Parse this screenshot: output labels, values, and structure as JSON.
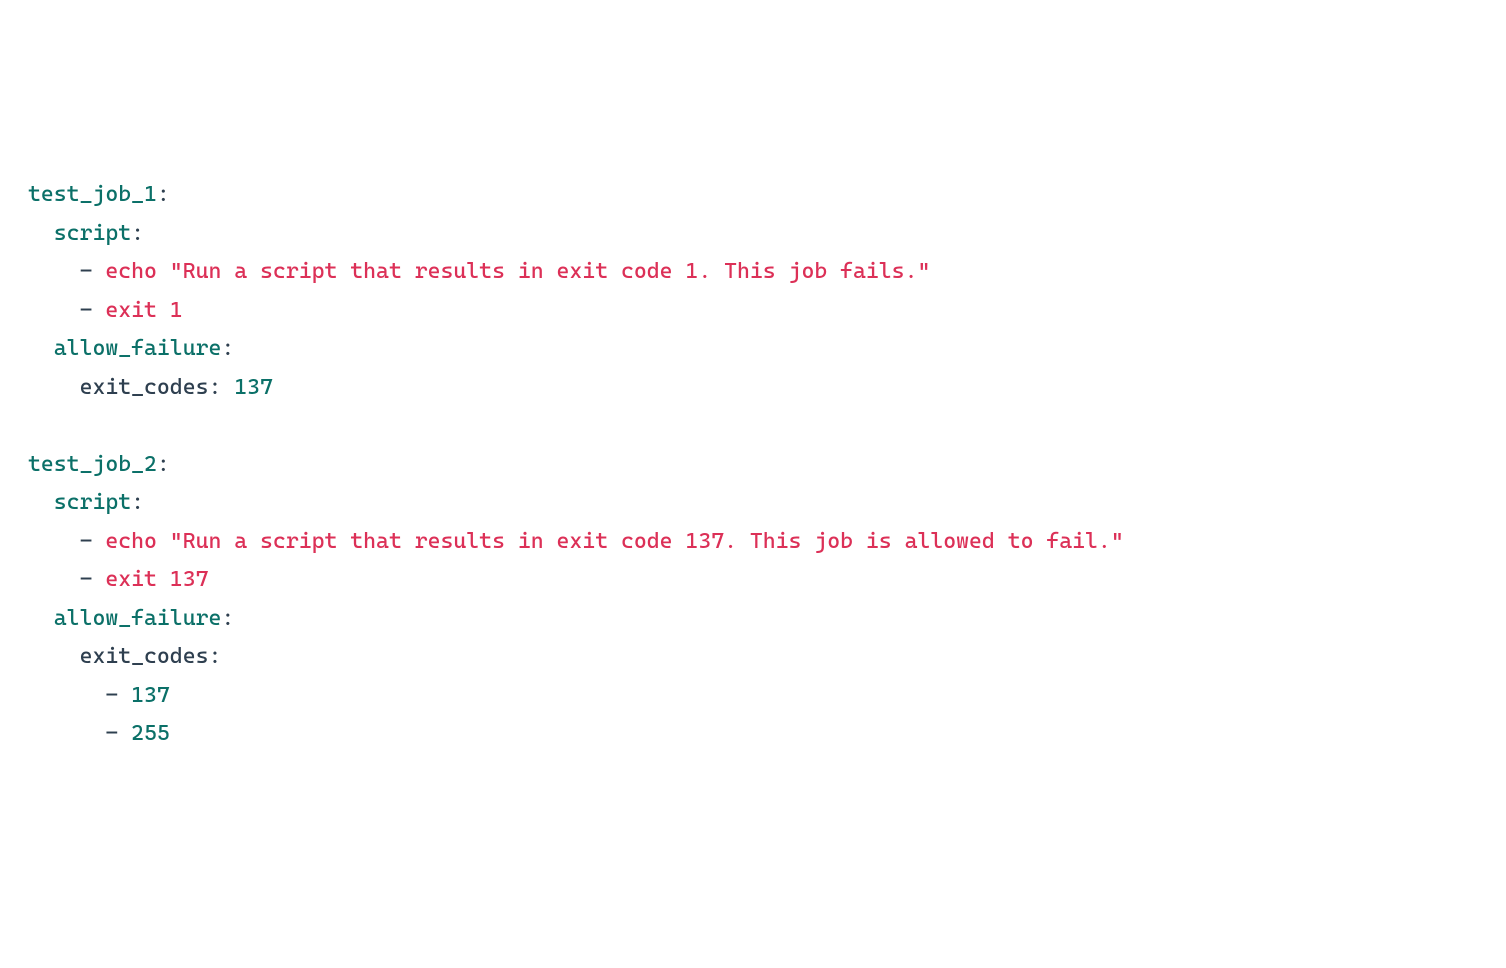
{
  "code": {
    "jobs": [
      {
        "name": "test_job_1",
        "script_key": "script",
        "script_lines": [
          "echo \"Run a script that results in exit code 1. This job fails.\"",
          "exit 1"
        ],
        "allow_failure_key": "allow_failure",
        "exit_codes_key": "exit_codes",
        "exit_codes_scalar": "137",
        "exit_codes_list": null
      },
      {
        "name": "test_job_2",
        "script_key": "script",
        "script_lines": [
          "echo \"Run a script that results in exit code 137. This job is allowed to fail.\"",
          "exit 137"
        ],
        "allow_failure_key": "allow_failure",
        "exit_codes_key": "exit_codes",
        "exit_codes_scalar": null,
        "exit_codes_list": [
          "137",
          "255"
        ]
      }
    ]
  },
  "tokens": {
    "colon": ":",
    "dash": "-",
    "space": " "
  }
}
